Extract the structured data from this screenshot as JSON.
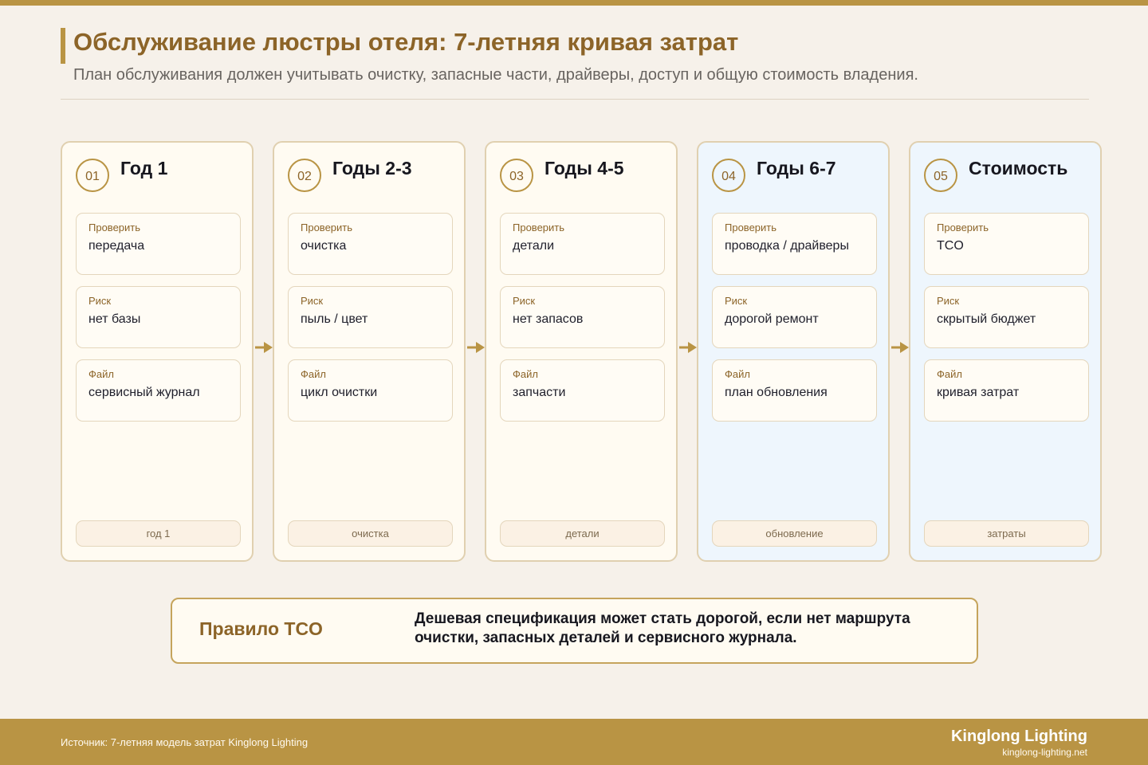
{
  "header": {
    "title": "Обслуживание люстры отеля: 7-летняя кривая затрат",
    "subtitle": "План обслуживания должен учитывать очистку, запасные части, драйверы, доступ и общую стоимость владения."
  },
  "colors": {
    "accent": "#b99444",
    "accent_dark": "#8c6428",
    "background": "#f6f1ea",
    "card": "#fffbf2",
    "card_highlight": "#eef6fd"
  },
  "stages": [
    {
      "num": "01",
      "title": "Год 1",
      "fields": [
        {
          "label": "Проверить",
          "value": "передача"
        },
        {
          "label": "Риск",
          "value": "нет базы"
        },
        {
          "label": "Файл",
          "value": "сервисный журнал"
        }
      ],
      "tag": "год 1"
    },
    {
      "num": "02",
      "title": "Годы 2-3",
      "fields": [
        {
          "label": "Проверить",
          "value": "очистка"
        },
        {
          "label": "Риск",
          "value": "пыль / цвет"
        },
        {
          "label": "Файл",
          "value": "цикл очистки"
        }
      ],
      "tag": "очистка"
    },
    {
      "num": "03",
      "title": "Годы 4-5",
      "fields": [
        {
          "label": "Проверить",
          "value": "детали"
        },
        {
          "label": "Риск",
          "value": "нет запасов"
        },
        {
          "label": "Файл",
          "value": "запчасти"
        }
      ],
      "tag": "детали"
    },
    {
      "num": "04",
      "title": "Годы 6-7",
      "fields": [
        {
          "label": "Проверить",
          "value": "проводка / драйверы"
        },
        {
          "label": "Риск",
          "value": "дорогой ремонт"
        },
        {
          "label": "Файл",
          "value": "план обновления"
        }
      ],
      "tag": "обновление"
    },
    {
      "num": "05",
      "title": "Стоимость",
      "fields": [
        {
          "label": "Проверить",
          "value": "TCO"
        },
        {
          "label": "Риск",
          "value": "скрытый бюджет"
        },
        {
          "label": "Файл",
          "value": "кривая затрат"
        }
      ],
      "tag": "затраты"
    }
  ],
  "arrows": {
    "icon": "arrow-right-icon"
  },
  "rule": {
    "label": "Правило TCO",
    "text": "Дешевая спецификация может стать дорогой, если нет маршрута очистки, запасных деталей и сервисного журнала."
  },
  "footer": {
    "source": "Источник: 7-летняя модель затрат Kinglong Lighting",
    "brand": "Kinglong Lighting",
    "site": "kinglong-lighting.net"
  }
}
